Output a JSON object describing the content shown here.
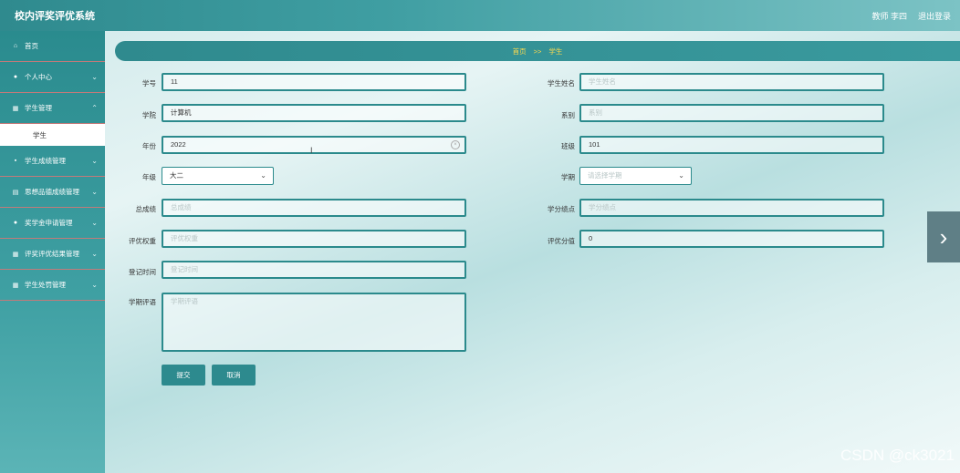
{
  "header": {
    "title": "校内评奖评优系统",
    "user": "教师 李四",
    "logout": "退出登录"
  },
  "sidebar": {
    "items": [
      {
        "label": "首页",
        "icon": "home-icon"
      },
      {
        "label": "个人中心",
        "icon": "person-icon"
      },
      {
        "label": "学生管理",
        "icon": "grid-icon",
        "sub": "学生"
      },
      {
        "label": "学生成绩管理",
        "icon": "chat-icon"
      },
      {
        "label": "思想品德成绩管理",
        "icon": "clipboard-icon"
      },
      {
        "label": "奖学金申请管理",
        "icon": "person-icon"
      },
      {
        "label": "评奖评优结果管理",
        "icon": "grid-icon"
      },
      {
        "label": "学生处罚管理",
        "icon": "grid-icon"
      }
    ]
  },
  "breadcrumb": {
    "home": "首页",
    "sep": ">>",
    "current": "学生"
  },
  "form": {
    "student_no": {
      "label": "学号",
      "value": "11"
    },
    "student_name": {
      "label": "学生姓名",
      "placeholder": "学生姓名"
    },
    "college": {
      "label": "学院",
      "value": "计算机"
    },
    "department": {
      "label": "系别",
      "placeholder": "系别"
    },
    "year": {
      "label": "年份",
      "value": "2022"
    },
    "class": {
      "label": "班级",
      "value": "101"
    },
    "grade": {
      "label": "年级",
      "value": "大二"
    },
    "semester": {
      "label": "学期",
      "placeholder": "请选择学期"
    },
    "total_score": {
      "label": "总成绩",
      "placeholder": "总成绩"
    },
    "gpa": {
      "label": "学分绩点",
      "placeholder": "学分绩点"
    },
    "eval_weight": {
      "label": "评优权重",
      "placeholder": "评优权重"
    },
    "eval_score": {
      "label": "评优分值",
      "value": "0"
    },
    "reg_time": {
      "label": "登记时间",
      "placeholder": "登记时间"
    },
    "semester_comment": {
      "label": "学期评语",
      "placeholder": "学期评语"
    },
    "submit": "提交",
    "cancel": "取消"
  },
  "watermark": "CSDN @ck3021"
}
